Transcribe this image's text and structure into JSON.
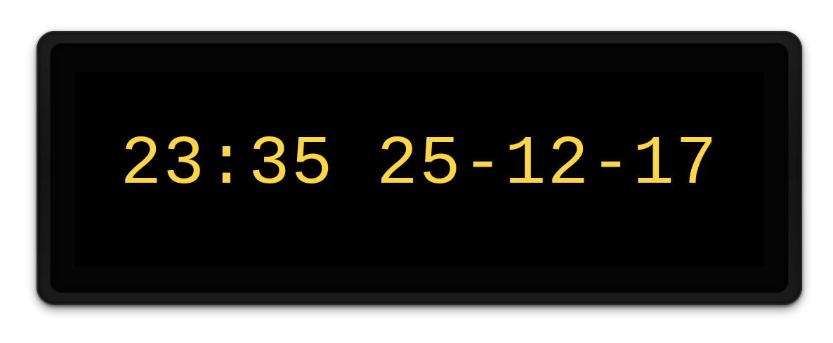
{
  "display": {
    "text": "23:35 25-12-17",
    "text_color": "#ffd54a",
    "screen_color": "#000000",
    "frame_color": "#1a1a1a"
  }
}
